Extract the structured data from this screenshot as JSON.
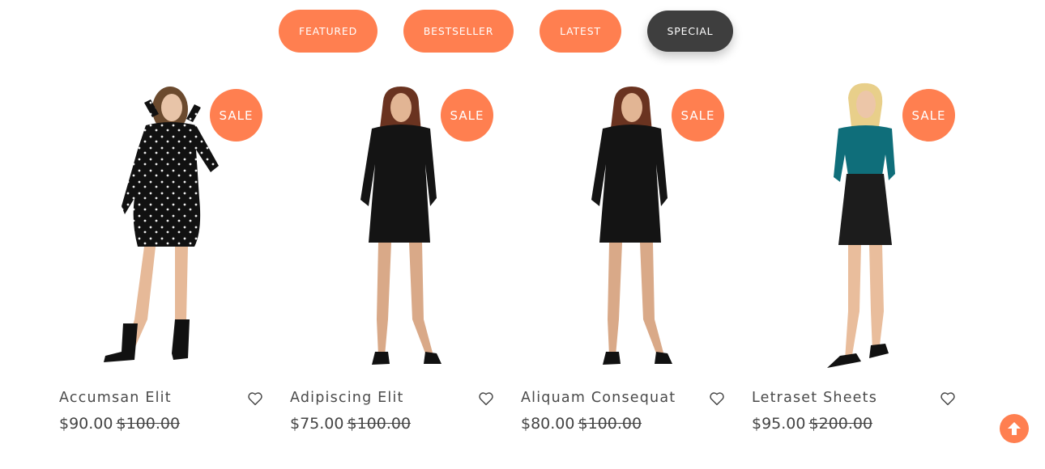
{
  "tabs": [
    {
      "label": "FEATURED",
      "active": false
    },
    {
      "label": "BESTSELLER",
      "active": false
    },
    {
      "label": "LATEST",
      "active": false
    },
    {
      "label": "SPECIAL",
      "active": true
    }
  ],
  "products": [
    {
      "name": "Accumsan Elit",
      "price": "$90.00",
      "old_price": "$100.00",
      "badge": "SALE",
      "image": "model-star-print-dress"
    },
    {
      "name": "Adipiscing Elit",
      "price": "$75.00",
      "old_price": "$100.00",
      "badge": "SALE",
      "image": "model-black-dress"
    },
    {
      "name": "Aliquam Consequat",
      "price": "$80.00",
      "old_price": "$100.00",
      "badge": "SALE",
      "image": "model-black-dress"
    },
    {
      "name": "Letraset Sheets",
      "price": "$95.00",
      "old_price": "$200.00",
      "badge": "SALE",
      "image": "model-teal-top-leather-skirt"
    }
  ],
  "colors": {
    "accent": "#ff7f50",
    "active_tab": "#3e3e3e",
    "text": "#444444"
  },
  "icons": {
    "wishlist": "heart-outline-icon",
    "scroll_top": "arrow-up-circle-icon"
  }
}
